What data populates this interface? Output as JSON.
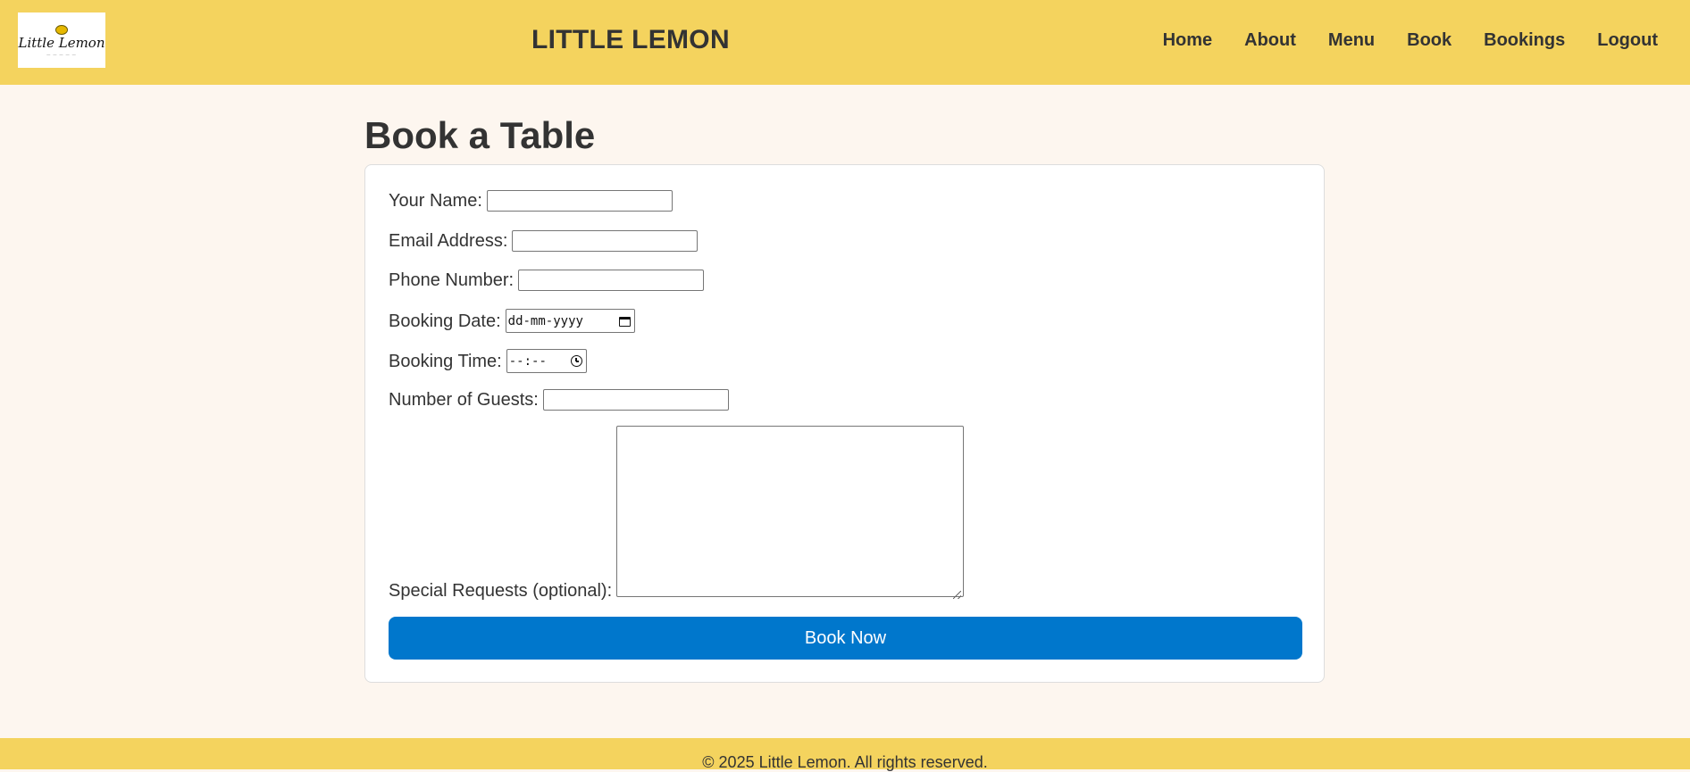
{
  "header": {
    "logo_text": "Little Lemon",
    "site_title": "LITTLE LEMON",
    "nav": [
      "Home",
      "About",
      "Menu",
      "Book",
      "Bookings",
      "Logout"
    ]
  },
  "main": {
    "page_title": "Book a Table",
    "form": {
      "name_label": "Your Name:",
      "email_label": "Email Address:",
      "phone_label": "Phone Number:",
      "date_label": "Booking Date:",
      "date_placeholder": "dd-mm-yyyy",
      "time_label": "Booking Time:",
      "time_placeholder": "--:--",
      "guests_label": "Number of Guests:",
      "requests_label": "Special Requests (optional):",
      "submit_label": "Book Now"
    }
  },
  "footer": {
    "text": "© 2025 Little Lemon. All rights reserved."
  },
  "colors": {
    "header_bg": "#f4d35e",
    "page_bg": "#fdf6ef",
    "button_bg": "#0077cc",
    "text": "#333333"
  },
  "icons": [
    "calendar-icon",
    "clock-icon",
    "resize-handle-icon"
  ]
}
